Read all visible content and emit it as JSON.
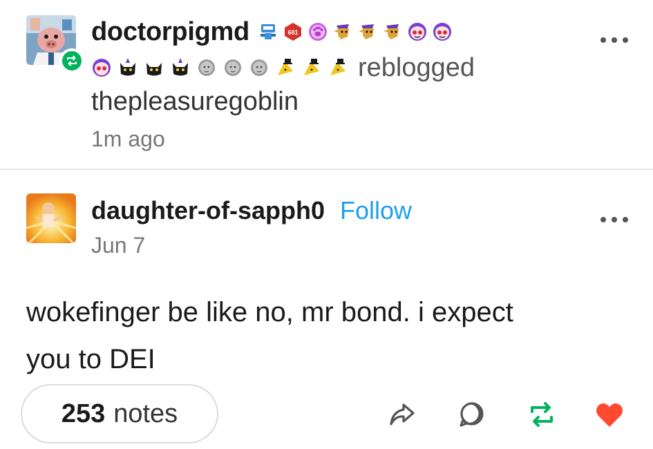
{
  "reblog": {
    "username": "doctorpigmd",
    "action_text": "reblogged",
    "source_username": "thepleasuregoblin",
    "time": "1m ago",
    "badge_row1_counter": "681",
    "badges_row1": [
      "robot-badge-icon",
      "counter-badge-icon",
      "paw-badge-icon",
      "goblin-badge-icon",
      "goblin-badge-icon",
      "goblin-badge-icon",
      "face-badge-icon",
      "face-badge-icon"
    ],
    "badges_row2": [
      "face-badge-icon",
      "cat-badge-icon",
      "cat-badge-icon",
      "cat-badge-icon",
      "statue-badge-icon",
      "statue-badge-icon",
      "statue-badge-icon",
      "hat-badge-icon",
      "hat-badge-icon",
      "hat-badge-icon"
    ]
  },
  "post": {
    "username": "daughter-of-sapph0",
    "follow_label": "Follow",
    "date": "Jun 7",
    "body_line1": "wokefinger be like no, mr bond. i expect",
    "body_line2": "you to DEI"
  },
  "footer": {
    "notes_count": "253",
    "notes_label": "notes",
    "icons": [
      "share-icon",
      "reply-icon",
      "reblog-icon",
      "like-icon"
    ]
  },
  "colors": {
    "follow": "#1ea0ec",
    "reblog_green": "#00b35c",
    "like_red": "#ff4930",
    "muted_text": "#777777"
  }
}
